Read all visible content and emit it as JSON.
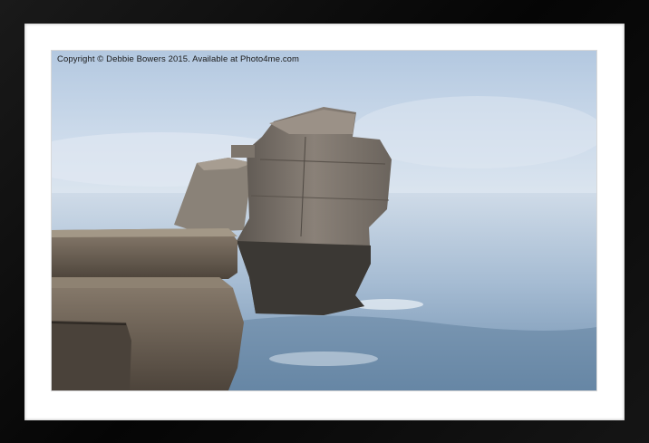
{
  "image": {
    "subject": "sea stack",
    "watermark": "Copyright © Debbie Bowers 2015. Available at Photo4me.com"
  },
  "colors": {
    "frame": "#0a0a0a",
    "mount": "#ffffff",
    "sky": "#c7d7ea",
    "sea": "#8fa9c3"
  }
}
